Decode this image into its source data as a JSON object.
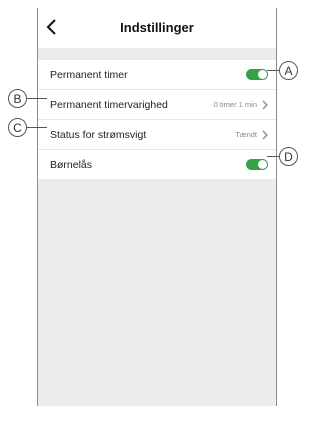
{
  "header": {
    "title": "Indstillinger",
    "back_icon": "chevron-left-icon"
  },
  "settings": [
    {
      "label": "Permanent timer",
      "control": "toggle",
      "on": true
    },
    {
      "label": "Permanent timervarighed",
      "value": "0 timer 1 min",
      "control": "chevron"
    },
    {
      "label": "Status for strømsvigt",
      "value": "Tændt",
      "control": "chevron"
    },
    {
      "label": "Børnelås",
      "control": "toggle",
      "on": true
    }
  ],
  "callouts": {
    "a": "A",
    "b": "B",
    "c": "C",
    "d": "D"
  },
  "colors": {
    "toggle_on": "#36a14a",
    "background": "#ececec"
  }
}
